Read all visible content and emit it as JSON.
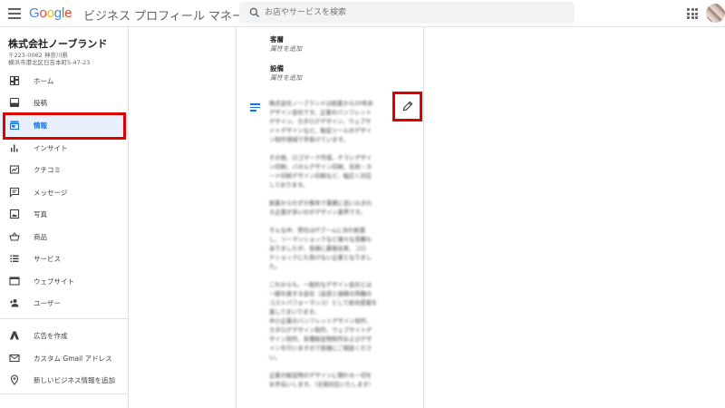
{
  "header": {
    "logo": "Google",
    "app_name": "ビジネス プロフィール マネージャ",
    "search_placeholder": "お店やサービスを検索"
  },
  "business": {
    "name": "株式会社ノーブランド",
    "postal": "〒223-0062 神奈川県",
    "address": "横浜市港北区日吉本町5-47-23"
  },
  "sidebar": {
    "items": [
      {
        "label": "ホーム",
        "icon": "dashboard-icon"
      },
      {
        "label": "投稿",
        "icon": "posts-icon"
      },
      {
        "label": "情報",
        "icon": "storefront-icon"
      },
      {
        "label": "インサイト",
        "icon": "bar-chart-icon"
      },
      {
        "label": "クチコミ",
        "icon": "reviews-icon"
      },
      {
        "label": "メッセージ",
        "icon": "message-icon"
      },
      {
        "label": "写真",
        "icon": "photo-icon"
      },
      {
        "label": "商品",
        "icon": "basket-icon"
      },
      {
        "label": "サービス",
        "icon": "list-icon"
      },
      {
        "label": "ウェブサイト",
        "icon": "website-icon"
      },
      {
        "label": "ユーザー",
        "icon": "add-person-icon"
      },
      {
        "label": "広告を作成",
        "icon": "google-ads-icon"
      },
      {
        "label": "カスタム Gmail アドレス",
        "icon": "mail-icon"
      },
      {
        "label": "新しいビジネス情報を追加",
        "icon": "location-pin-icon"
      }
    ],
    "active_index": 2
  },
  "main": {
    "attributes": [
      {
        "title": "客層",
        "action": "属性を追加"
      },
      {
        "title": "設備",
        "action": "属性を追加"
      }
    ],
    "description": "株式会社ノーブランドは創業から20年余\nデザイン会社です。企業のパンフレット\nデザイン、カタログデザイン、ウェブサ\nイトデザインなど、販促ツールのデザイ\nン制作領域で手掛けています。\n\nその他、ロゴマーク作成、チラシデザイ\nン印刷、パネルデザイン印刷、名刺・カ\nード印刷デザイン印刷など、幅広く対応\nしております。\n\n創業からわずか数年で業績に追い込まれ\nる企業が多いのがデザイン業界です。\n\nそんな中、弊社はITブームに合わ創業\nし、リーマンショックなど様々な苦難も\nありましたが、皆様に最後出来、コロ\nナショックにも負けない企業となりまし\nた。\n\nこれからも、一般的なデザイン会社とは\n一線を画する会社（品質と価格の両輪の\nコストパフォーマンス）として総合提案を\n進してまいります。\n中小企業のパンフレットデザイン制作、\nカタログデザイン制作、ウェブサイトデ\nザイン制作、各種販促物制作およびデザ\nインを行いますので皆様にご相談くださ\nい。\n\n企業の販促物のデザインに関わる一切を\nお手伝いします。（全国対応いたします）"
  },
  "colors": {
    "accent": "#1a73e8",
    "highlight": "#e00000",
    "active_bg": "#e8f0fe"
  }
}
